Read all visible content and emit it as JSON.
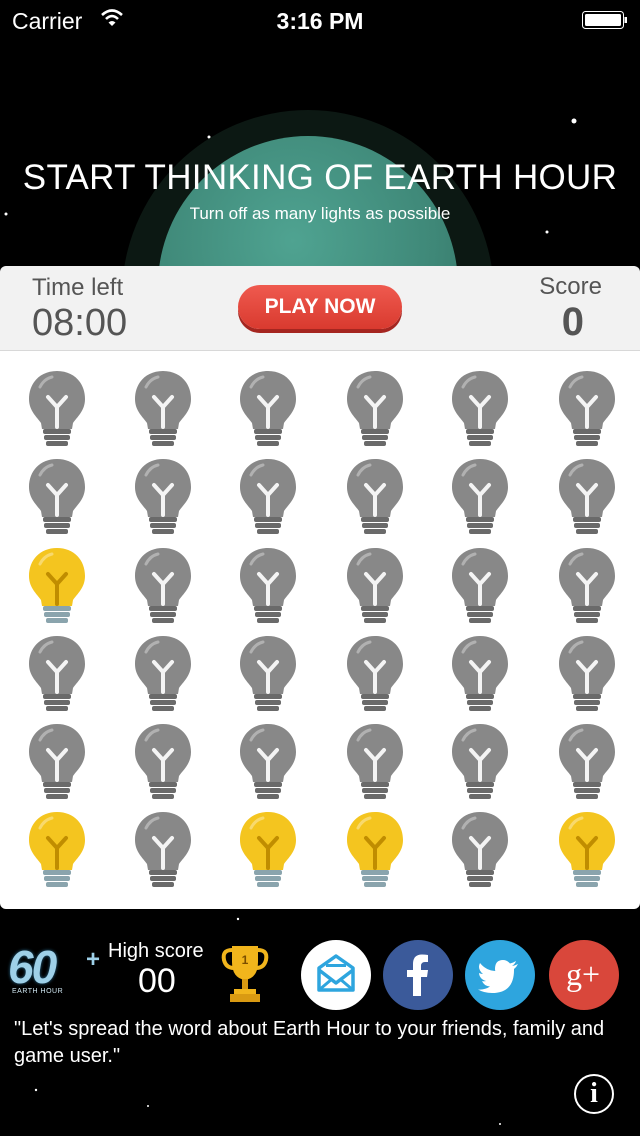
{
  "status_bar": {
    "carrier": "Carrier",
    "time": "3:16 PM"
  },
  "hero": {
    "title": "START THINKING OF EARTH HOUR",
    "subtitle": "Turn off as many lights as possible"
  },
  "game_header": {
    "time_label": "Time left",
    "time_value": "08:00",
    "play_label": "PLAY NOW",
    "score_label": "Score",
    "score_value": "0"
  },
  "grid": {
    "columns": 6,
    "rows": [
      [
        "off",
        "off",
        "off",
        "off",
        "off",
        "off"
      ],
      [
        "off",
        "off",
        "off",
        "off",
        "off",
        "off"
      ],
      [
        "on",
        "off",
        "off",
        "off",
        "off",
        "off"
      ],
      [
        "off",
        "off",
        "off",
        "off",
        "off",
        "off"
      ],
      [
        "off",
        "off",
        "off",
        "off",
        "off",
        "off"
      ],
      [
        "on",
        "off",
        "on",
        "on",
        "off",
        "on"
      ]
    ]
  },
  "footer": {
    "logo_text": "60",
    "logo_plus": "+",
    "logo_sub": "EARTH HOUR",
    "high_score_label": "High score",
    "high_score_value": "00",
    "trophy_rank": "1",
    "message": "\"Let's spread the word about Earth Hour to your friends, family and game user.\"",
    "info_label": "i"
  },
  "share_buttons": [
    {
      "name": "email",
      "icon": "envelope-icon",
      "color": "#ffffff"
    },
    {
      "name": "facebook",
      "icon": "facebook-icon",
      "color": "#3b5a9a"
    },
    {
      "name": "twitter",
      "icon": "twitter-icon",
      "color": "#2ea5de"
    },
    {
      "name": "google-plus",
      "icon": "google-plus-icon",
      "color": "#d9473b"
    }
  ],
  "colors": {
    "bulb_on": "#f4c51f",
    "bulb_off": "#888888",
    "accent_red": "#e2453a"
  }
}
